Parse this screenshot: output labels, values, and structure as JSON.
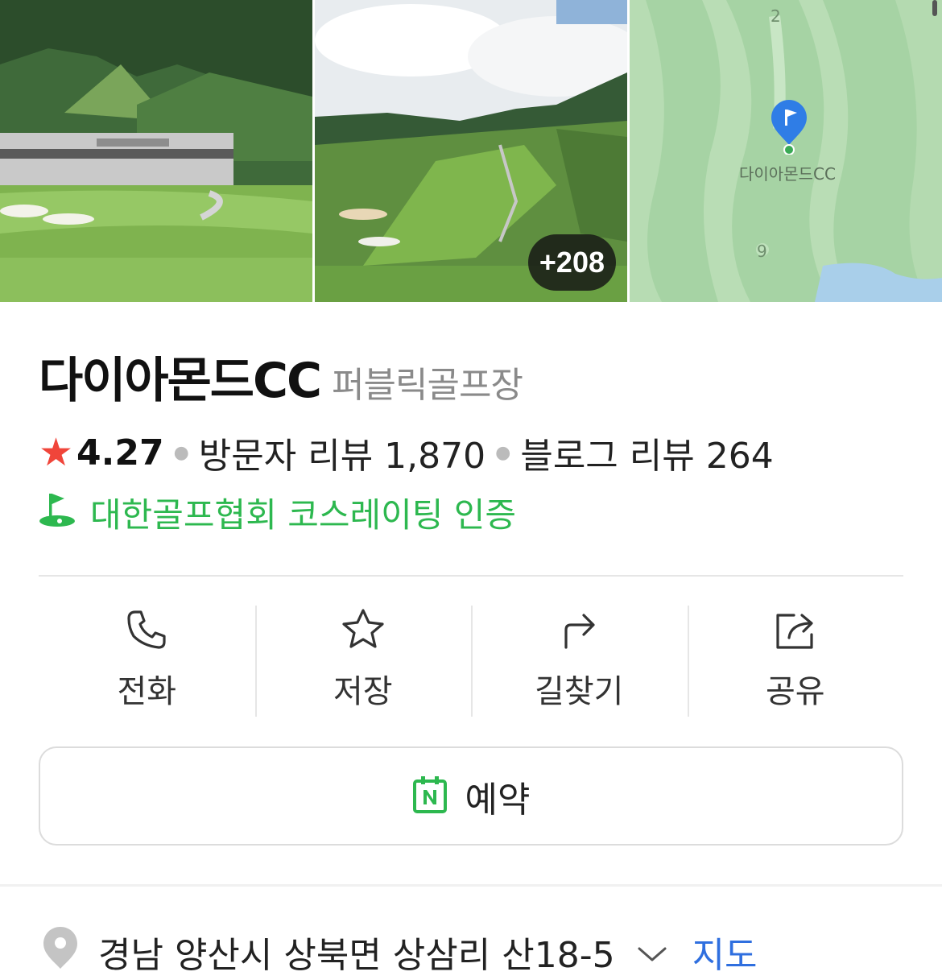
{
  "photos": {
    "more_count": "+208",
    "map_pin_label": "다이아몬드CC",
    "map_hole_numbers": [
      "2",
      "9"
    ]
  },
  "place": {
    "name": "다이아몬드CC",
    "category": "퍼블릭골프장",
    "rating": "4.27",
    "visitor_reviews": "방문자 리뷰 1,870",
    "blog_reviews": "블로그 리뷰 264",
    "certification": "대한골프협회 코스레이팅 인증"
  },
  "actions": [
    {
      "label": "전화",
      "icon": "phone-icon"
    },
    {
      "label": "저장",
      "icon": "star-outline-icon"
    },
    {
      "label": "길찾기",
      "icon": "directions-icon"
    },
    {
      "label": "공유",
      "icon": "share-icon"
    }
  ],
  "reserve": {
    "label": "예약",
    "icon": "naver-calendar-icon"
  },
  "address": {
    "text": "경남 양산시 상북면 상삼리 산18-5",
    "map_link": "지도"
  },
  "colors": {
    "accent_green": "#2db84f",
    "star_red": "#f0453a",
    "link_blue": "#2f6fdf"
  }
}
